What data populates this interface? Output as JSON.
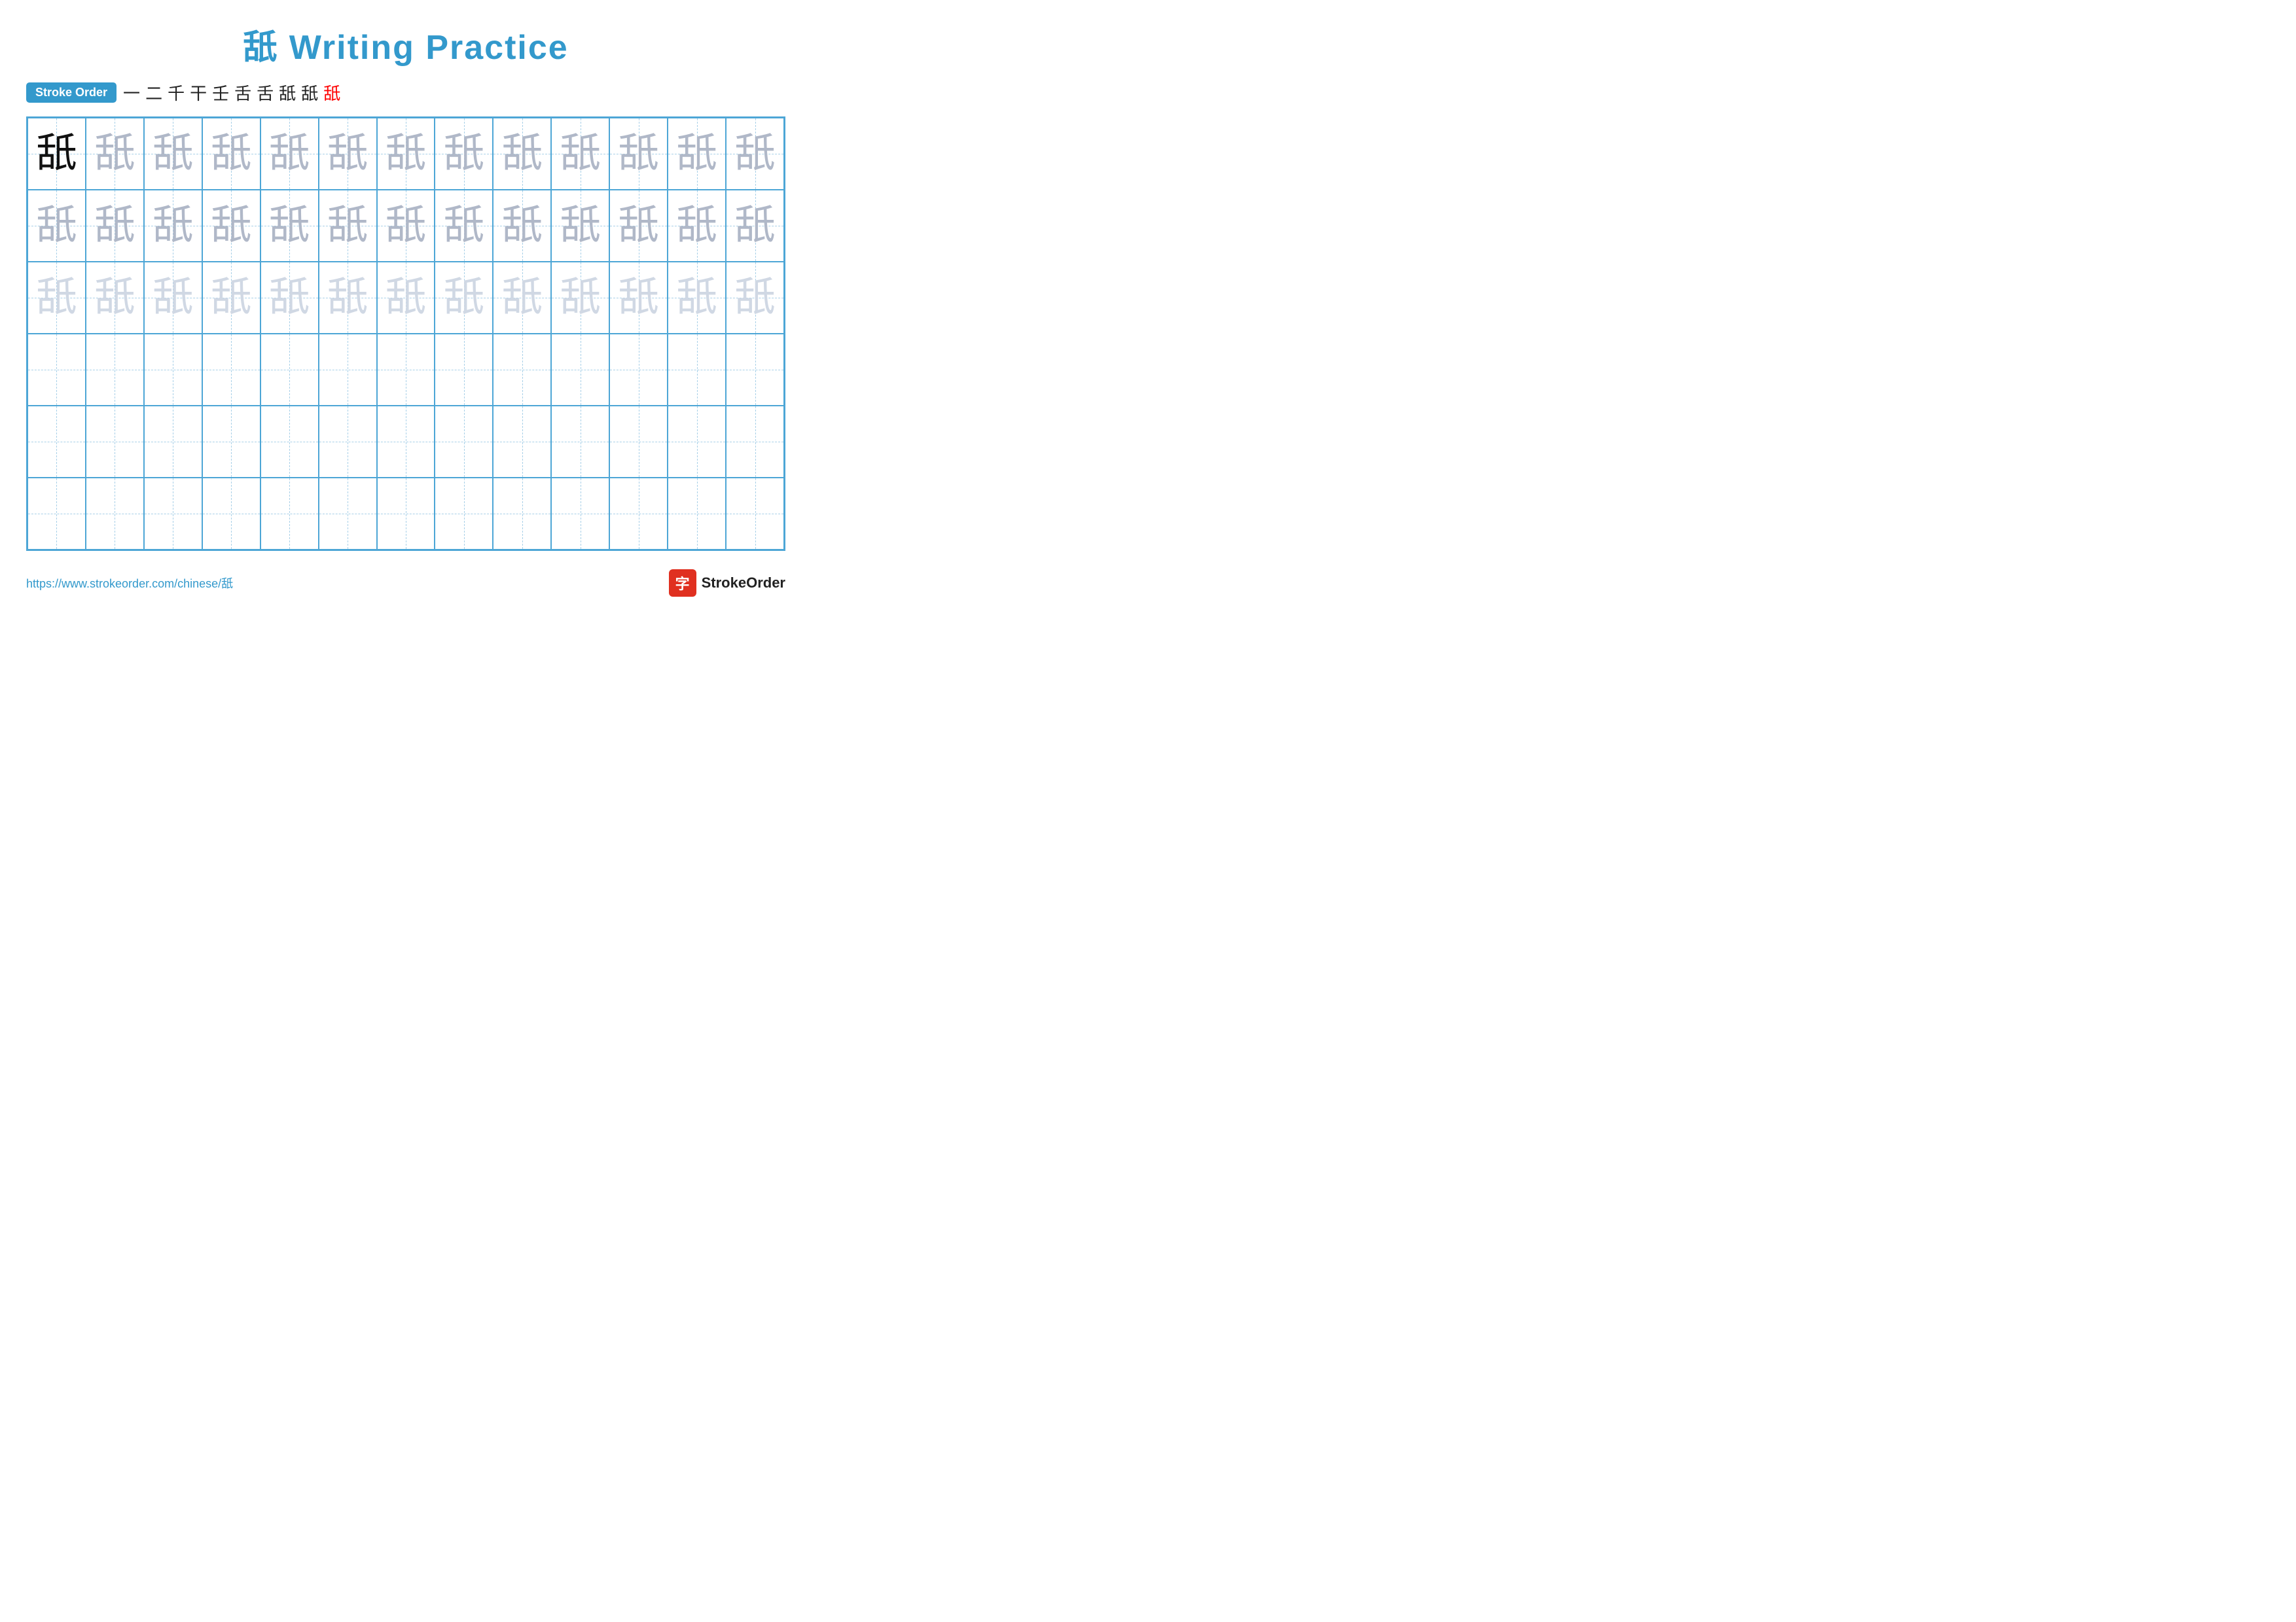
{
  "title": {
    "text": "舐 Writing Practice",
    "chinese_char": "舐"
  },
  "stroke_order": {
    "badge_label": "Stroke Order",
    "steps": [
      "一",
      "二",
      "千",
      "干",
      "壬",
      "舌",
      "舌",
      "舐",
      "舐",
      "舐"
    ]
  },
  "grid": {
    "rows": 6,
    "cols": 13,
    "character": "舐",
    "row_styles": [
      [
        "dark",
        "medium-gray",
        "medium-gray",
        "medium-gray",
        "medium-gray",
        "medium-gray",
        "medium-gray",
        "medium-gray",
        "medium-gray",
        "medium-gray",
        "medium-gray",
        "medium-gray",
        "medium-gray"
      ],
      [
        "medium-gray",
        "medium-gray",
        "medium-gray",
        "medium-gray",
        "medium-gray",
        "medium-gray",
        "medium-gray",
        "medium-gray",
        "medium-gray",
        "medium-gray",
        "medium-gray",
        "medium-gray",
        "medium-gray"
      ],
      [
        "light-gray",
        "light-gray",
        "light-gray",
        "light-gray",
        "light-gray",
        "light-gray",
        "light-gray",
        "light-gray",
        "light-gray",
        "light-gray",
        "light-gray",
        "light-gray",
        "light-gray"
      ],
      [
        "empty",
        "empty",
        "empty",
        "empty",
        "empty",
        "empty",
        "empty",
        "empty",
        "empty",
        "empty",
        "empty",
        "empty",
        "empty"
      ],
      [
        "empty",
        "empty",
        "empty",
        "empty",
        "empty",
        "empty",
        "empty",
        "empty",
        "empty",
        "empty",
        "empty",
        "empty",
        "empty"
      ],
      [
        "empty",
        "empty",
        "empty",
        "empty",
        "empty",
        "empty",
        "empty",
        "empty",
        "empty",
        "empty",
        "empty",
        "empty",
        "empty"
      ]
    ]
  },
  "footer": {
    "url": "https://www.strokeorder.com/chinese/舐",
    "logo_char": "字",
    "logo_text": "StrokeOrder"
  }
}
